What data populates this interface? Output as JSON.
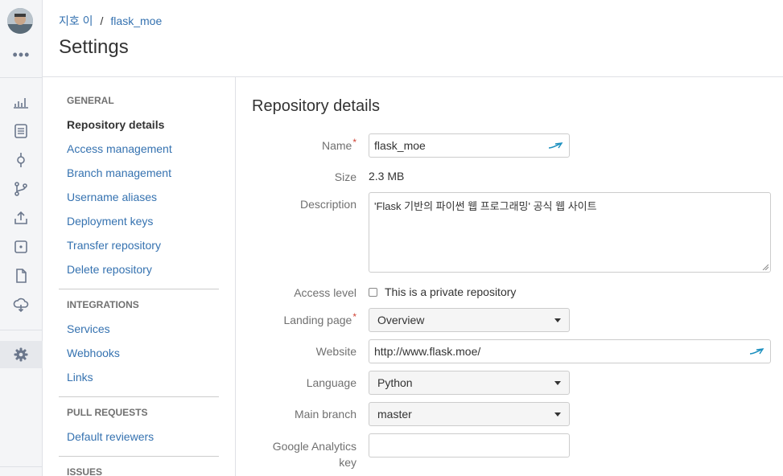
{
  "breadcrumb": {
    "user": "지호 이",
    "separator": "/",
    "repo": "flask_moe"
  },
  "page_title": "Settings",
  "rail": {
    "more": "•••",
    "icons": [
      "overview-icon",
      "source-icon",
      "commits-icon",
      "branches-icon",
      "pull-requests-icon",
      "pipelines-icon",
      "downloads-icon",
      "deployments-icon",
      "settings-icon"
    ]
  },
  "nav": {
    "general_head": "GENERAL",
    "general": [
      "Repository details",
      "Access management",
      "Branch management",
      "Username aliases",
      "Deployment keys",
      "Transfer repository",
      "Delete repository"
    ],
    "integrations_head": "INTEGRATIONS",
    "integrations": [
      "Services",
      "Webhooks",
      "Links"
    ],
    "pr_head": "PULL REQUESTS",
    "pr": [
      "Default reviewers"
    ],
    "issues_head": "ISSUES"
  },
  "form": {
    "title": "Repository details",
    "name_label": "Name",
    "name_value": "flask_moe",
    "size_label": "Size",
    "size_value": "2.3 MB",
    "description_label": "Description",
    "description_value": "'Flask 기반의 파이썬 웹 프로그래밍' 공식 웹 사이트",
    "access_label": "Access level",
    "access_check_label": "This is a private repository",
    "landing_label": "Landing page",
    "landing_value": "Overview",
    "website_label": "Website",
    "website_value": "http://www.flask.moe/",
    "language_label": "Language",
    "language_value": "Python",
    "branch_label": "Main branch",
    "branch_value": "master",
    "ga_label_1": "Google Analytics",
    "ga_label_2": "key",
    "ga_value": "",
    "required_mark": "*"
  },
  "colors": {
    "link": "#3572b0",
    "required": "#d04437",
    "rail_bg": "#f4f5f7"
  }
}
